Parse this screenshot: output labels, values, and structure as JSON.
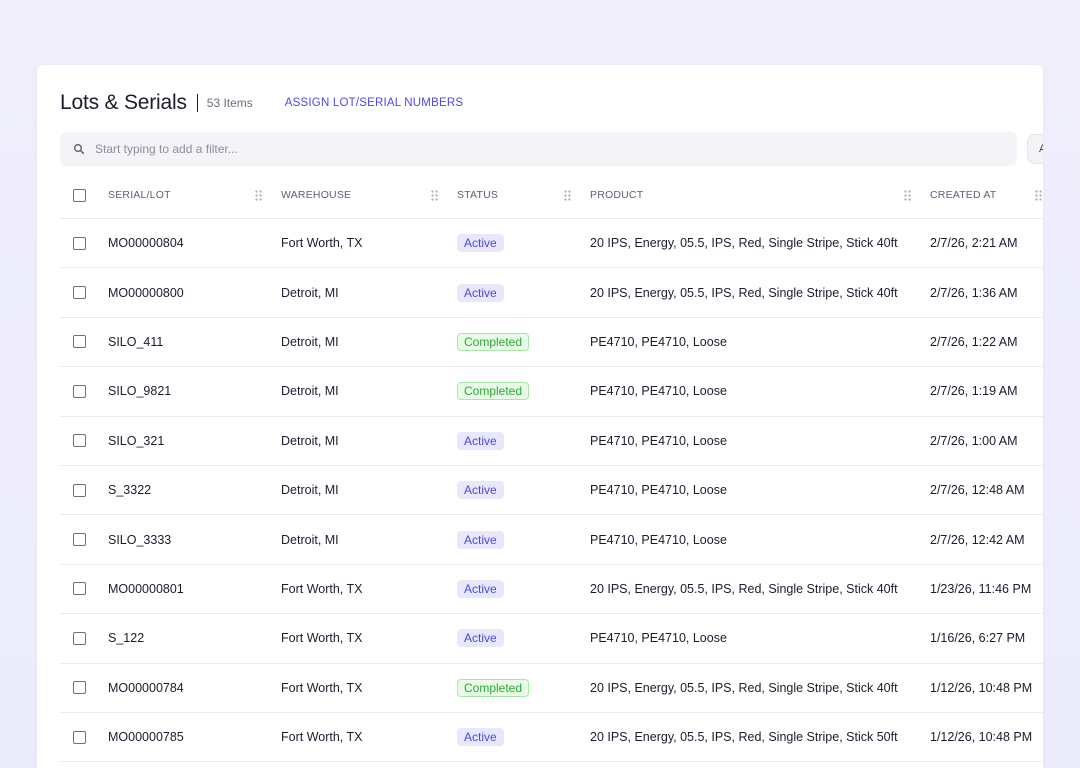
{
  "header": {
    "title": "Lots & Serials",
    "count": "53 Items",
    "assign_label": "ASSIGN LOT/SERIAL NUMBERS"
  },
  "filter": {
    "placeholder": "Start typing to add a filter...",
    "side_button_label": "A"
  },
  "columns": {
    "serial": "SERIAL/LOT",
    "warehouse": "WAREHOUSE",
    "status": "STATUS",
    "product": "PRODUCT",
    "created": "CREATED AT"
  },
  "colors": {
    "accent": "#4f46e5",
    "active_badge_bg": "#e8e8fb",
    "completed_text": "#2aa838",
    "completed_bg": "#e9fbe7"
  },
  "rows": [
    {
      "serial": "MO00000804",
      "warehouse": "Fort Worth, TX",
      "status": "Active",
      "product": "20 IPS, Energy, 05.5, IPS, Red, Single Stripe, Stick 40ft",
      "created": "2/7/26, 2:21 AM"
    },
    {
      "serial": "MO00000800",
      "warehouse": "Detroit, MI",
      "status": "Active",
      "product": "20 IPS, Energy, 05.5, IPS, Red, Single Stripe, Stick 40ft",
      "created": "2/7/26, 1:36 AM"
    },
    {
      "serial": "SILO_411",
      "warehouse": "Detroit, MI",
      "status": "Completed",
      "product": "PE4710, PE4710, Loose",
      "created": "2/7/26, 1:22 AM"
    },
    {
      "serial": "SILO_9821",
      "warehouse": "Detroit, MI",
      "status": "Completed",
      "product": "PE4710, PE4710, Loose",
      "created": "2/7/26, 1:19 AM"
    },
    {
      "serial": "SILO_321",
      "warehouse": "Detroit, MI",
      "status": "Active",
      "product": "PE4710, PE4710, Loose",
      "created": "2/7/26, 1:00 AM"
    },
    {
      "serial": "S_3322",
      "warehouse": "Detroit, MI",
      "status": "Active",
      "product": "PE4710, PE4710, Loose",
      "created": "2/7/26, 12:48 AM"
    },
    {
      "serial": "SILO_3333",
      "warehouse": "Detroit, MI",
      "status": "Active",
      "product": "PE4710, PE4710, Loose",
      "created": "2/7/26, 12:42 AM"
    },
    {
      "serial": "MO00000801",
      "warehouse": "Fort Worth, TX",
      "status": "Active",
      "product": "20 IPS, Energy, 05.5, IPS, Red, Single Stripe, Stick 40ft",
      "created": "1/23/26, 11:46 PM"
    },
    {
      "serial": "S_122",
      "warehouse": "Fort Worth, TX",
      "status": "Active",
      "product": "PE4710, PE4710, Loose",
      "created": "1/16/26, 6:27 PM"
    },
    {
      "serial": "MO00000784",
      "warehouse": "Fort Worth, TX",
      "status": "Completed",
      "product": "20 IPS, Energy, 05.5, IPS, Red, Single Stripe, Stick 40ft",
      "created": "1/12/26, 10:48 PM"
    },
    {
      "serial": "MO00000785",
      "warehouse": "Fort Worth, TX",
      "status": "Active",
      "product": "20 IPS, Energy, 05.5, IPS, Red, Single Stripe, Stick 50ft",
      "created": "1/12/26, 10:48 PM"
    }
  ]
}
